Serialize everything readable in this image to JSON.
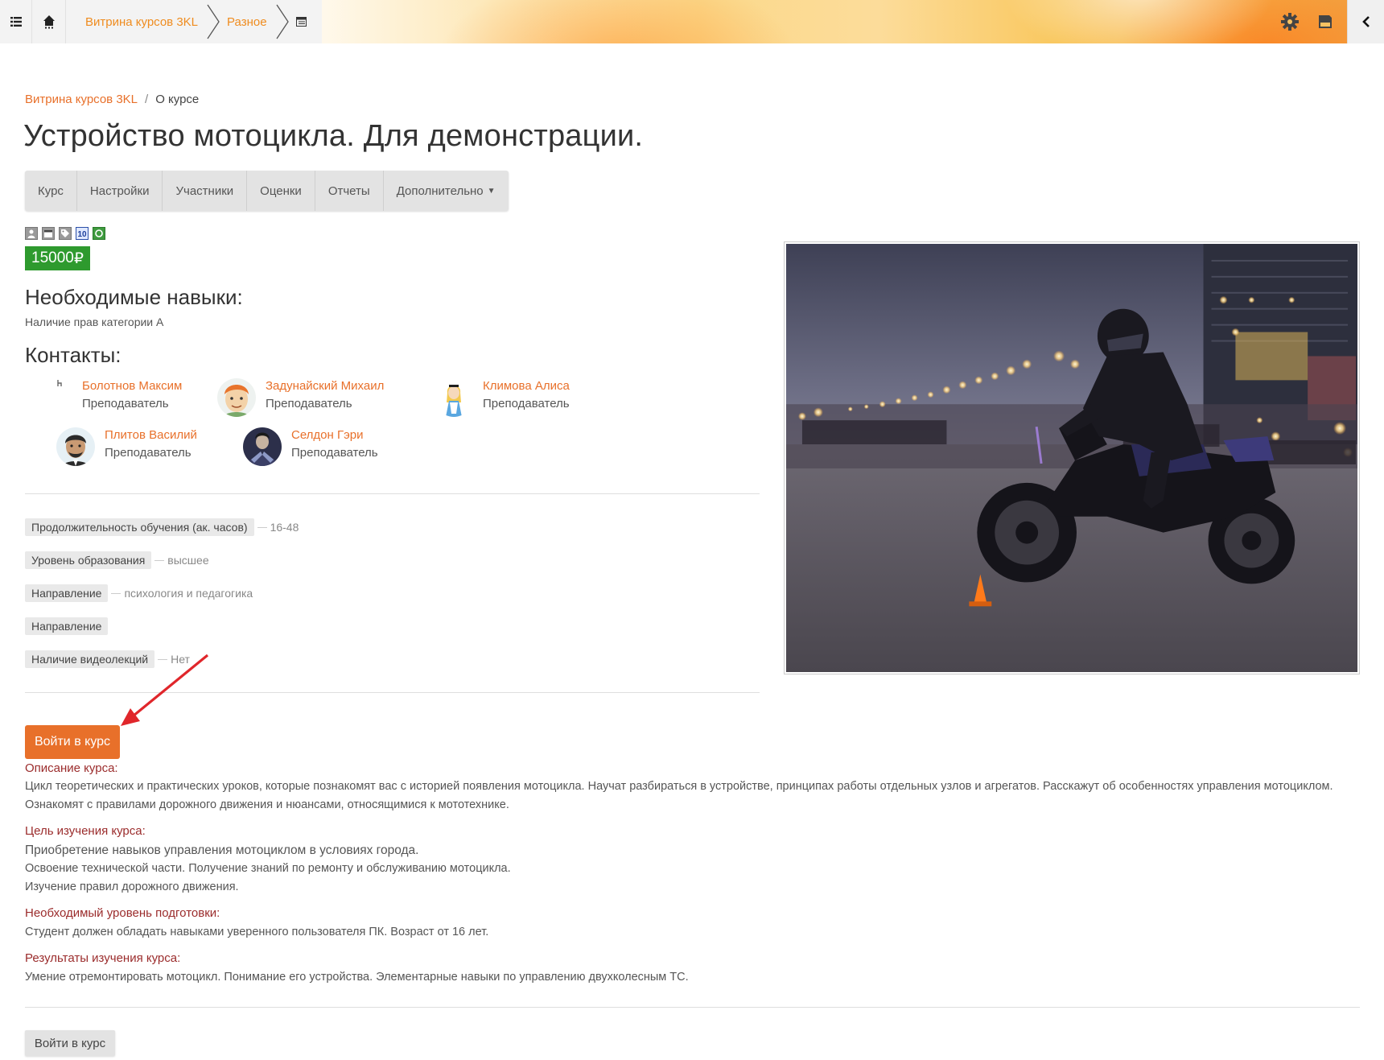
{
  "topbar": {
    "breadcrumbs": [
      "Витрина курсов 3KL",
      "Разное"
    ],
    "icons": [
      "menu-list-icon",
      "home-icon",
      "course-page-icon",
      "gear-icon",
      "save-icon",
      "chevron-left-icon"
    ]
  },
  "breadcrumb": {
    "root": "Витрина курсов 3KL",
    "separator": "/",
    "current": "О курсе"
  },
  "page_title": "Устройство мотоцикла. Для демонстрации.",
  "tabs": [
    "Курс",
    "Настройки",
    "Участники",
    "Оценки",
    "Отчеты",
    "Дополнительно"
  ],
  "price": {
    "amount": "15000",
    "currency": "₽"
  },
  "skills": {
    "heading": "Необходимые навыки:",
    "text": "Наличие прав категории А"
  },
  "contacts": {
    "heading": "Контакты:",
    "people": [
      {
        "name": "Болотнов Максим",
        "role": "Преподаватель"
      },
      {
        "name": "Задунайский Михаил",
        "role": "Преподаватель"
      },
      {
        "name": "Климова Алиса",
        "role": "Преподаватель"
      },
      {
        "name": "Плитов Василий",
        "role": "Преподаватель"
      },
      {
        "name": "Селдон Гэри",
        "role": "Преподаватель"
      }
    ]
  },
  "fields": [
    {
      "label": "Продолжительность обучения (ак. часов)",
      "value": "16-48"
    },
    {
      "label": "Уровень образования",
      "value": "высшее"
    },
    {
      "label": "Направление",
      "value": "психология и педагогика"
    },
    {
      "label": "Направление",
      "value": ""
    },
    {
      "label": "Наличие видеолекций",
      "value": "Нет"
    }
  ],
  "enter_button": "Войти в курс",
  "description": {
    "about_heading": "Описание курса:",
    "about_text": "Цикл теоретических и практических уроков, которые познакомят вас с историей появления мотоцикла. Научат разбираться в устройстве, принципах работы отдельных узлов и агрегатов. Расскажут об особенностях управления мотоциклом.  Ознакомят с правилами дорожного движения и нюансами, относящимися к мототехнике.",
    "goal_heading": "Цель изучения курса:",
    "goal_lines": [
      "Приобретение навыков управления мотоциклом в условиях города.",
      "Освоение технической части. Получение знаний по ремонту и обслуживанию мотоцикла.",
      "Изучение правил дорожного движения."
    ],
    "level_heading": "Необходимый уровень подготовки:",
    "level_text": "Студент должен обладать навыками уверенного пользователя ПК. Возраст от 16 лет.",
    "results_heading": "Результаты изучения курса:",
    "results_text": "Умение отремонтировать мотоцикл. Понимание его устройства. Элементарные навыки по управлению двухколесным ТС."
  },
  "colors": {
    "accent": "#e8702a",
    "price_green": "#2e9a2e",
    "heading_dark_red": "#9b2c2c",
    "annotation_arrow": "#e0262b"
  }
}
